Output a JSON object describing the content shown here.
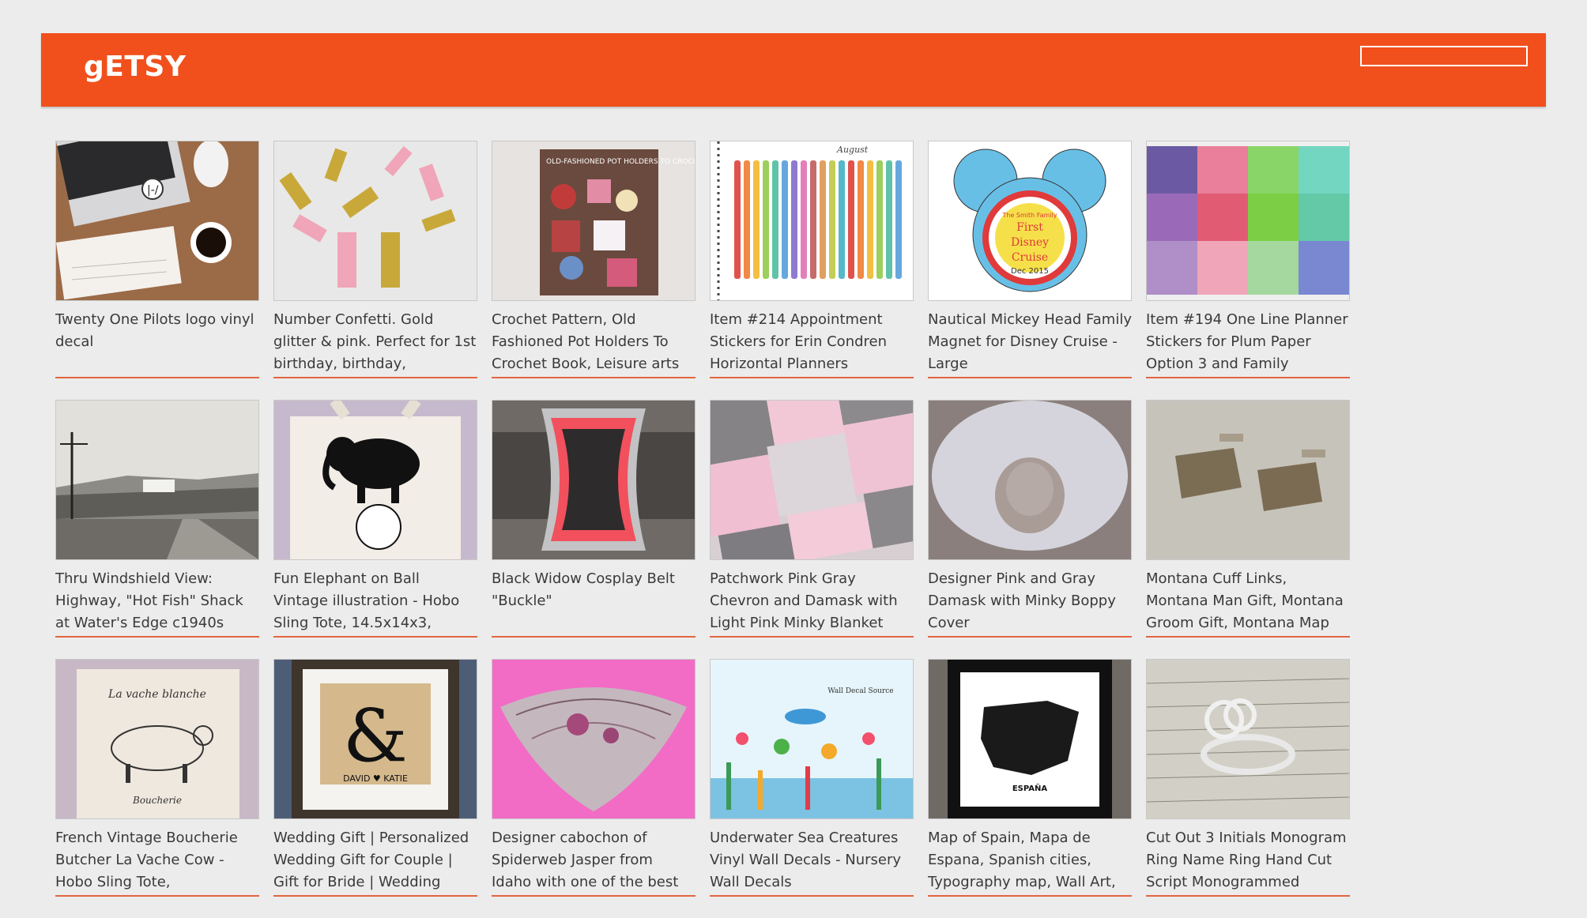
{
  "header": {
    "logo": "gETSY",
    "search_placeholder": "",
    "brand_color": "#f1501c"
  },
  "listings": [
    {
      "title": "Twenty One Pilots logo vinyl decal",
      "image": "laptop-desk-photo"
    },
    {
      "title": "Number Confetti. Gold glitter & pink. Perfect for 1st birthday, birthday,",
      "image": "number-confetti-photo"
    },
    {
      "title": "Crochet Pattern, Old Fashioned Pot Holders To Crochet Book, Leisure arts",
      "image": "crochet-book-photo"
    },
    {
      "title": "Item #214 Appointment Stickers for Erin Condren Horizontal Planners",
      "image": "planner-stickers-photo"
    },
    {
      "title": "Nautical Mickey Head Family Magnet for Disney Cruise - Large",
      "image": "mickey-magnet-photo"
    },
    {
      "title": "Item #194 One Line Planner Stickers for Plum Paper Option 3 and Family",
      "image": "color-swatch-stickers-photo"
    },
    {
      "title": "Thru Windshield View: Highway, \"Hot Fish\" Shack at Water's Edge c1940s",
      "image": "vintage-highway-photo"
    },
    {
      "title": "Fun Elephant on Ball Vintage illustration - Hobo Sling Tote, 14.5x14x3,",
      "image": "elephant-tote-photo"
    },
    {
      "title": "Black Widow Cosplay Belt \"Buckle\"",
      "image": "belt-buckle-photo"
    },
    {
      "title": "Patchwork Pink Gray Chevron and Damask with Light Pink Minky Blanket",
      "image": "patchwork-blanket-photo"
    },
    {
      "title": "Designer Pink and Gray Damask with Minky Boppy Cover",
      "image": "boppy-cover-photo"
    },
    {
      "title": "Montana Cuff Links, Montana Man Gift, Montana Groom Gift, Montana Map",
      "image": "cufflinks-photo"
    },
    {
      "title": "French Vintage Boucherie Butcher La Vache Cow - Hobo Sling Tote,",
      "image": "cow-tote-photo"
    },
    {
      "title": "Wedding Gift | Personalized Wedding Gift for Couple | Gift for Bride | Wedding",
      "image": "ampersand-frame-photo"
    },
    {
      "title": "Designer cabochon of Spiderweb Jasper from Idaho with one of the best",
      "image": "jasper-cabochon-photo"
    },
    {
      "title": "Underwater Sea Creatures Vinyl Wall Decals - Nursery Wall Decals",
      "image": "sea-decals-photo"
    },
    {
      "title": "Map of Spain, Mapa de Espana, Spanish cities, Typography map, Wall Art,",
      "image": "spain-map-photo"
    },
    {
      "title": "Cut Out 3 Initials Monogram Ring Name Ring Hand Cut Script Monogrammed",
      "image": "monogram-ring-photo"
    }
  ],
  "image_text": {
    "crochet_cover": "OLD-FASHIONED POT HOLDERS TO CROCHET",
    "planner_month": "August",
    "magnet_lines": [
      "The Smith Family",
      "First",
      "Disney",
      "Cruise",
      "Dec 2015"
    ],
    "frame_names": "DAVID ♥ KATIE",
    "decal_source": "Wall Decal Source",
    "map_label": "ESPAÑA",
    "tote_script": "La vache blanche",
    "tote_footer": "Boucherie"
  }
}
